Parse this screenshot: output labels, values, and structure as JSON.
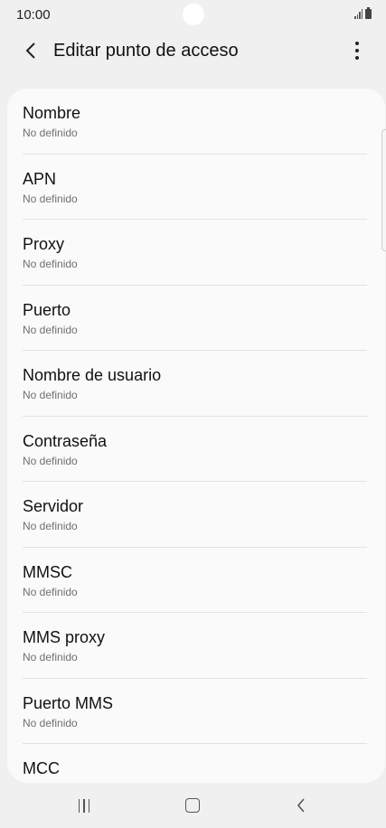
{
  "status_bar": {
    "time": "10:00"
  },
  "app_bar": {
    "title": "Editar punto de acceso"
  },
  "items": [
    {
      "label": "Nombre",
      "value": "No definido"
    },
    {
      "label": "APN",
      "value": "No definido"
    },
    {
      "label": "Proxy",
      "value": "No definido"
    },
    {
      "label": "Puerto",
      "value": "No definido"
    },
    {
      "label": "Nombre de usuario",
      "value": "No definido"
    },
    {
      "label": "Contraseña",
      "value": "No definido"
    },
    {
      "label": "Servidor",
      "value": "No definido"
    },
    {
      "label": "MMSC",
      "value": "No definido"
    },
    {
      "label": "MMS proxy",
      "value": "No definido"
    },
    {
      "label": "Puerto MMS",
      "value": "No definido"
    },
    {
      "label": "MCC",
      "value": ""
    }
  ],
  "icons": {
    "back": "chevron-left-icon",
    "more": "more-vertical-icon",
    "signal": "signal-icon",
    "battery": "battery-icon",
    "recents": "recents-icon",
    "home": "home-icon",
    "nav_back": "back-icon"
  }
}
